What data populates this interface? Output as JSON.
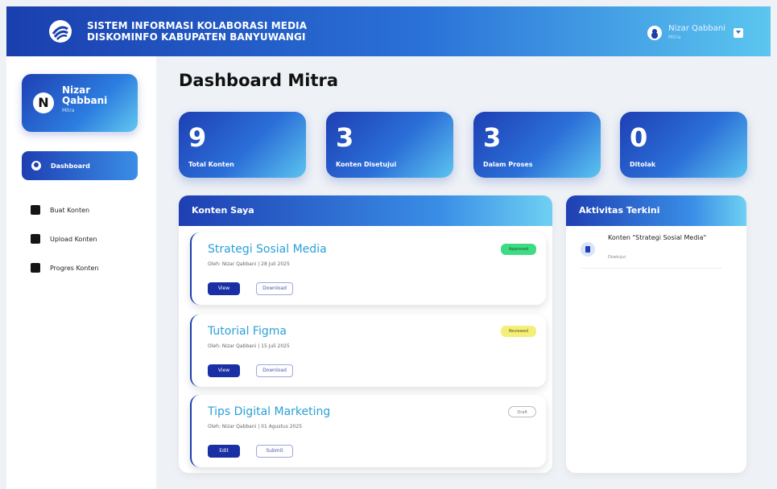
{
  "header": {
    "title_line1": "SISTEM INFORMASI KOLABORASI MEDIA",
    "title_line2": "DISKOMINFO KABUPATEN BANYUWANGI",
    "user_name": "Nizar Qabbani",
    "user_role": "Mitra"
  },
  "sidebar": {
    "profile": {
      "initial": "N",
      "name": "Nizar Qabbani",
      "role": "Mitra"
    },
    "items": [
      {
        "label": "Dashboard",
        "icon": "dashboard-icon",
        "active": true
      },
      {
        "label": "Buat Konten",
        "icon": "create-icon"
      },
      {
        "label": "Upload Konten",
        "icon": "upload-icon"
      },
      {
        "label": "Progres Konten",
        "icon": "progress-icon"
      }
    ]
  },
  "main": {
    "title": "Dashboard Mitra",
    "stats": [
      {
        "value": "9",
        "label": "Total Konten"
      },
      {
        "value": "3",
        "label": "Konten Disetujui"
      },
      {
        "value": "3",
        "label": "Dalam Proses"
      },
      {
        "value": "0",
        "label": "Ditolak"
      }
    ],
    "konten_panel": {
      "title": "Konten Saya",
      "items": [
        {
          "title": "Strategi Sosial Media",
          "meta": "Oleh: Nizar Qabbani | 28 Juli 2025",
          "badge": "Approved",
          "badge_color": "#3ddc84",
          "primary": "View",
          "secondary": "Download"
        },
        {
          "title": "Tutorial Figma",
          "meta": "Oleh: Nizar Qabbani | 15 Juli 2025",
          "badge": "Reviewed",
          "badge_color": "#f4ef7a",
          "primary": "View",
          "secondary": "Download"
        },
        {
          "title": "Tips Digital Marketing",
          "meta": "Oleh: Nizar Qabbani | 01 Agustus 2025",
          "badge": "Draft",
          "badge_color": "#ffffff",
          "primary": "Edit",
          "secondary": "Submit"
        }
      ]
    },
    "activity_panel": {
      "title": "Aktivitas Terkini",
      "items": [
        {
          "text": "Konten \"Strategi Sosial Media\"",
          "sub": "Disetujui"
        }
      ]
    }
  }
}
